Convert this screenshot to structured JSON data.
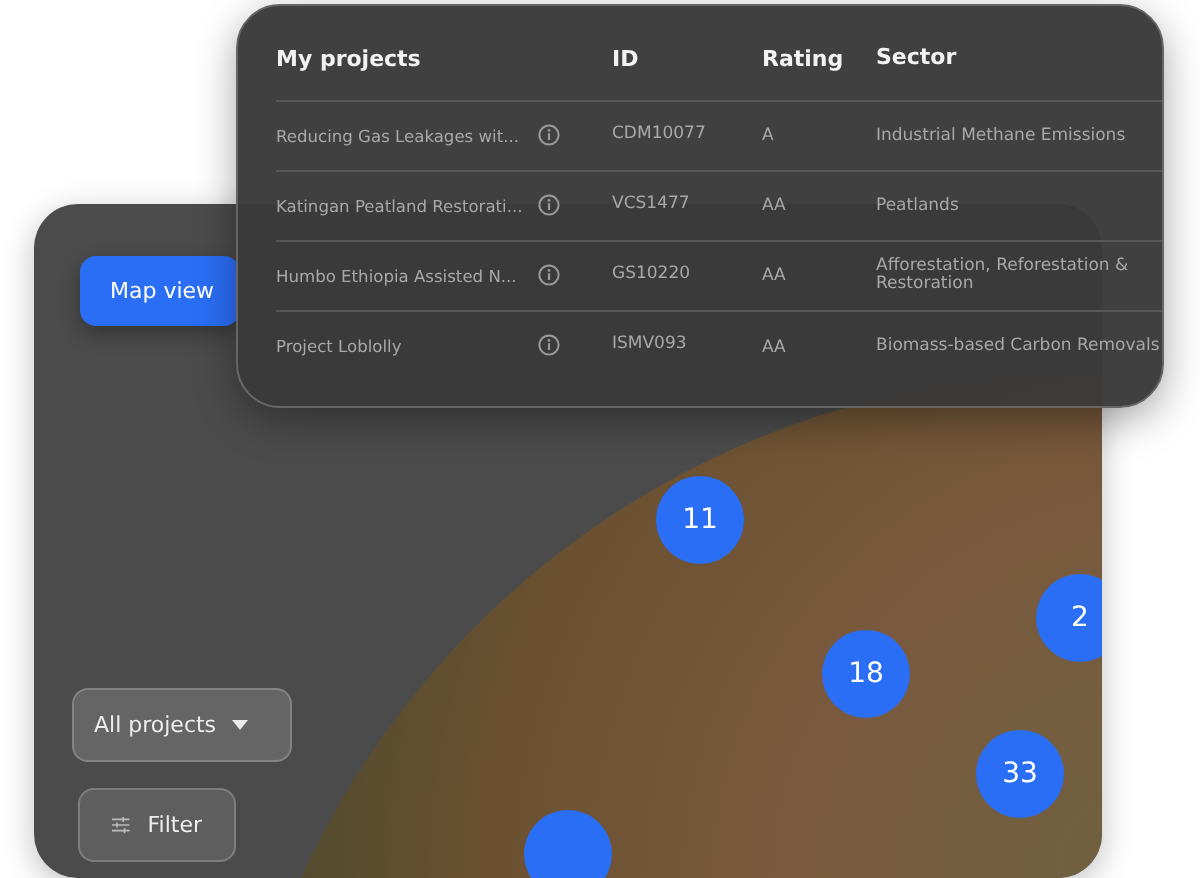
{
  "map_panel": {
    "view_button": {
      "label": "Map view"
    },
    "project_dropdown": {
      "value": "All projects"
    },
    "filter_button": {
      "label": "Filter"
    },
    "markers": [
      {
        "kind": "cluster",
        "label": "11"
      },
      {
        "kind": "cluster",
        "label": "18"
      },
      {
        "kind": "cluster",
        "label": "2"
      },
      {
        "kind": "cluster",
        "label": "33"
      },
      {
        "kind": "cluster"
      }
    ]
  },
  "projects_table": {
    "columns": [
      "My projects",
      "ID",
      "Rating",
      "Sector"
    ],
    "rows": [
      {
        "name": "Reducing Gas Leakages wit...",
        "id": "CDM10077",
        "rating": "A",
        "sector": "Industrial Methane Emissions"
      },
      {
        "name": "Katingan Peatland Restorati...",
        "id": "VCS1477",
        "rating": "AA",
        "sector": "Peatlands"
      },
      {
        "name": "Humbo Ethiopia Assisted N...",
        "id": "GS10220",
        "rating": "AA",
        "sector": "Afforestation, Reforestation & Restoration"
      },
      {
        "name": "Project Loblolly",
        "id": "ISMV093",
        "rating": "AA",
        "sector": "Biomass-based Carbon Removals"
      }
    ]
  }
}
